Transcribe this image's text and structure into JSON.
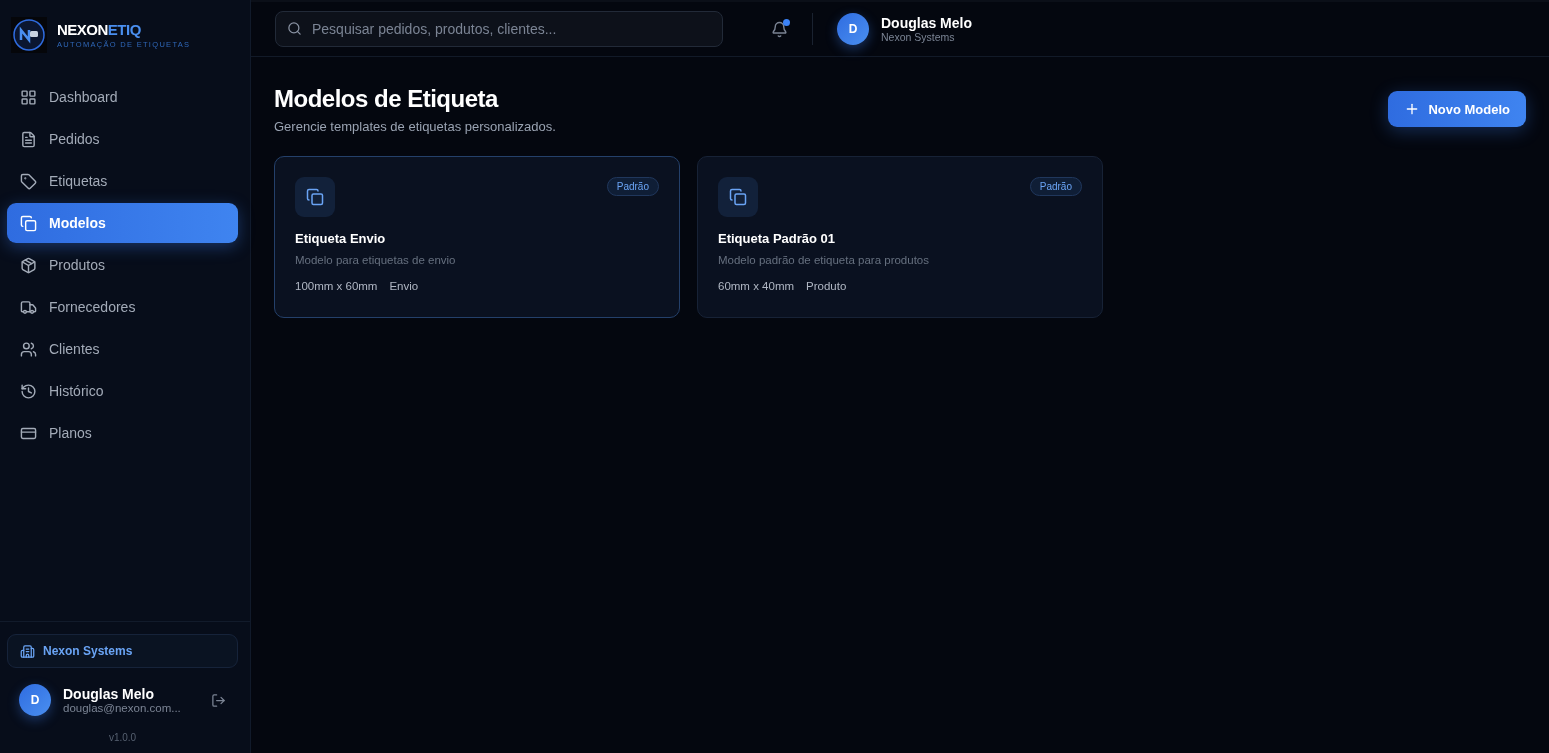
{
  "brand": {
    "name": "NEXON",
    "accent": "ETIQ",
    "tagline": "AUTOMAÇÃO DE ETIQUETAS"
  },
  "sidebar": {
    "items": [
      {
        "label": "Dashboard",
        "selected": false
      },
      {
        "label": "Pedidos",
        "selected": false
      },
      {
        "label": "Etiquetas",
        "selected": false
      },
      {
        "label": "Modelos",
        "selected": true
      },
      {
        "label": "Produtos",
        "selected": false
      },
      {
        "label": "Fornecedores",
        "selected": false
      },
      {
        "label": "Clientes",
        "selected": false
      },
      {
        "label": "Histórico",
        "selected": false
      },
      {
        "label": "Planos",
        "selected": false
      }
    ],
    "company": "Nexon Systems",
    "user": {
      "initial": "D",
      "name": "Douglas Melo",
      "email": "douglas@nexon.com..."
    },
    "version": "v1.0.0"
  },
  "header": {
    "search": {
      "placeholder": "Pesquisar pedidos, produtos, clientes..."
    },
    "notification_unread": true,
    "user": {
      "initial": "D",
      "name": "Douglas Melo",
      "company": "Nexon Systems"
    }
  },
  "page": {
    "title": "Modelos de Etiqueta",
    "subtitle": "Gerencie templates de etiquetas personalizados.",
    "new_button": "Novo Modelo"
  },
  "cards": [
    {
      "badge": "Padrão",
      "title": "Etiqueta Envio",
      "description": "Modelo para etiquetas de envio",
      "size": "100mm x 60mm",
      "type": "Envio",
      "selected": true
    },
    {
      "badge": "Padrão",
      "title": "Etiqueta Padrão 01",
      "description": "Modelo padrão de etiqueta para produtos",
      "size": "60mm x 40mm",
      "type": "Produto",
      "selected": false
    }
  ]
}
